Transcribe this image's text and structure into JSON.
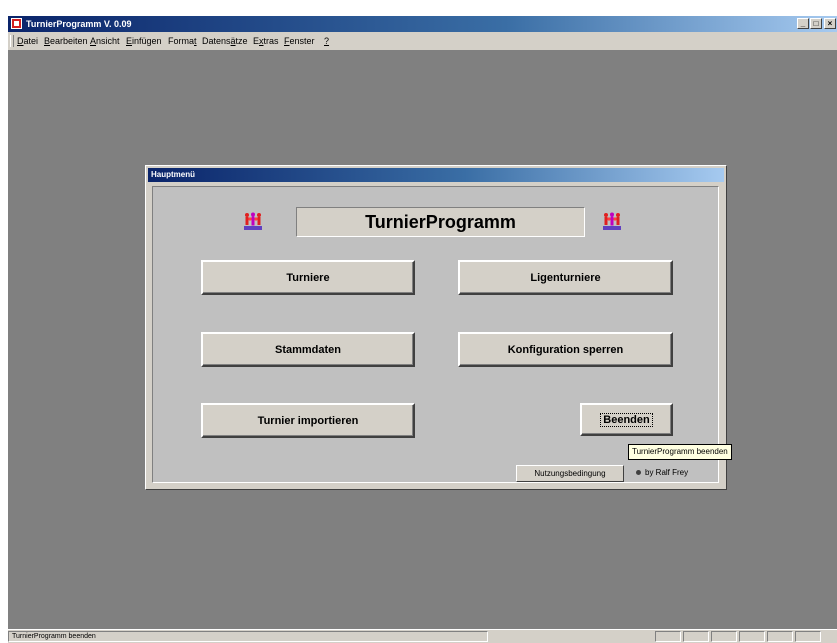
{
  "app": {
    "title": "TurnierProgramm V. 0.09",
    "window_controls": [
      "_",
      "□",
      "×"
    ]
  },
  "menu": {
    "items": [
      {
        "pre": "",
        "ul": "D",
        "post": "atei"
      },
      {
        "pre": "",
        "ul": "B",
        "post": "earbeiten"
      },
      {
        "pre": "",
        "ul": "A",
        "post": "nsicht"
      },
      {
        "pre": "",
        "ul": "E",
        "post": "infügen"
      },
      {
        "pre": "Forma",
        "ul": "t",
        "post": ""
      },
      {
        "pre": "Datens",
        "ul": "ä",
        "post": "tze"
      },
      {
        "pre": "E",
        "ul": "x",
        "post": "tras"
      },
      {
        "pre": "",
        "ul": "F",
        "post": "enster"
      },
      {
        "pre": "",
        "ul": "?",
        "post": ""
      }
    ]
  },
  "dialog": {
    "title": "Hauptmenü",
    "heading": "TurnierProgramm",
    "icon": "people-icon",
    "buttons": {
      "turniere": "Turniere",
      "ligenturniere": "Ligenturniere",
      "stammdaten": "Stammdaten",
      "konfiguration": "Konfiguration sperren",
      "import": "Turnier importieren",
      "beenden": "Beenden",
      "nutzung": "Nutzungsbedingung"
    },
    "credit": "by Ralf Frey"
  },
  "tooltip": "TurnierProgramm beenden",
  "status": {
    "text": "TurnierProgramm beenden"
  },
  "colors": {
    "titlebar_start": "#0a246a",
    "titlebar_end": "#a6caf0",
    "workspace": "#808080",
    "face": "#d4d0c8",
    "tooltip_bg": "#ffffe1"
  }
}
